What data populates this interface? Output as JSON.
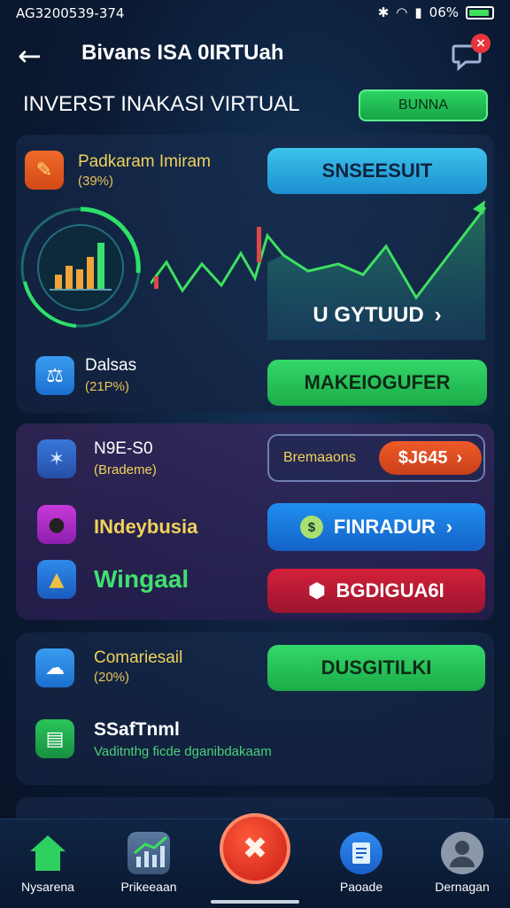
{
  "status_bar": {
    "time": "AG3200539-374",
    "battery": "06%",
    "battery_level": 0.9
  },
  "header": {
    "title": "Bivans ISA 0IRTUah",
    "notification_count": "×"
  },
  "subheader": {
    "label": "INVERST INAKASI VIRTUAL",
    "button": "BUNNA"
  },
  "rows": [
    {
      "name": "Padkaram Imiram",
      "pct": "(39%)",
      "button": "SNSEESUIT"
    },
    {
      "name": "Dalsas",
      "pct": "(21P%)",
      "button": "MAKEIOGUFER"
    }
  ],
  "chart": {
    "button": "U GYTUUD"
  },
  "mid_section": {
    "items": [
      {
        "name": "N9E-S0",
        "sub": "(Brademe)"
      },
      {
        "name": "INdeybusia",
        "sub": ""
      },
      {
        "name": "Wingaal",
        "sub": ""
      }
    ],
    "price_label": "Bremaaons",
    "price": "$J645",
    "btn_blue": "FINRADUR",
    "btn_red": "BGDIGUA6I"
  },
  "lower_section": {
    "item1": {
      "name": "Comariesail",
      "pct": "(20%)",
      "button": "DUSGITILKI"
    },
    "item2": {
      "name": "SSafTnml",
      "desc": "Vaditnthg ficde dganibdakaam"
    }
  },
  "nav": [
    {
      "label": "Nysarena"
    },
    {
      "label": "Prikeeaan"
    },
    {
      "label": "Paoade"
    },
    {
      "label": "Dernagan"
    }
  ],
  "colors": {
    "accent_green": "#22c55a",
    "accent_blue": "#2fb0e8",
    "accent_red": "#c2183a"
  }
}
